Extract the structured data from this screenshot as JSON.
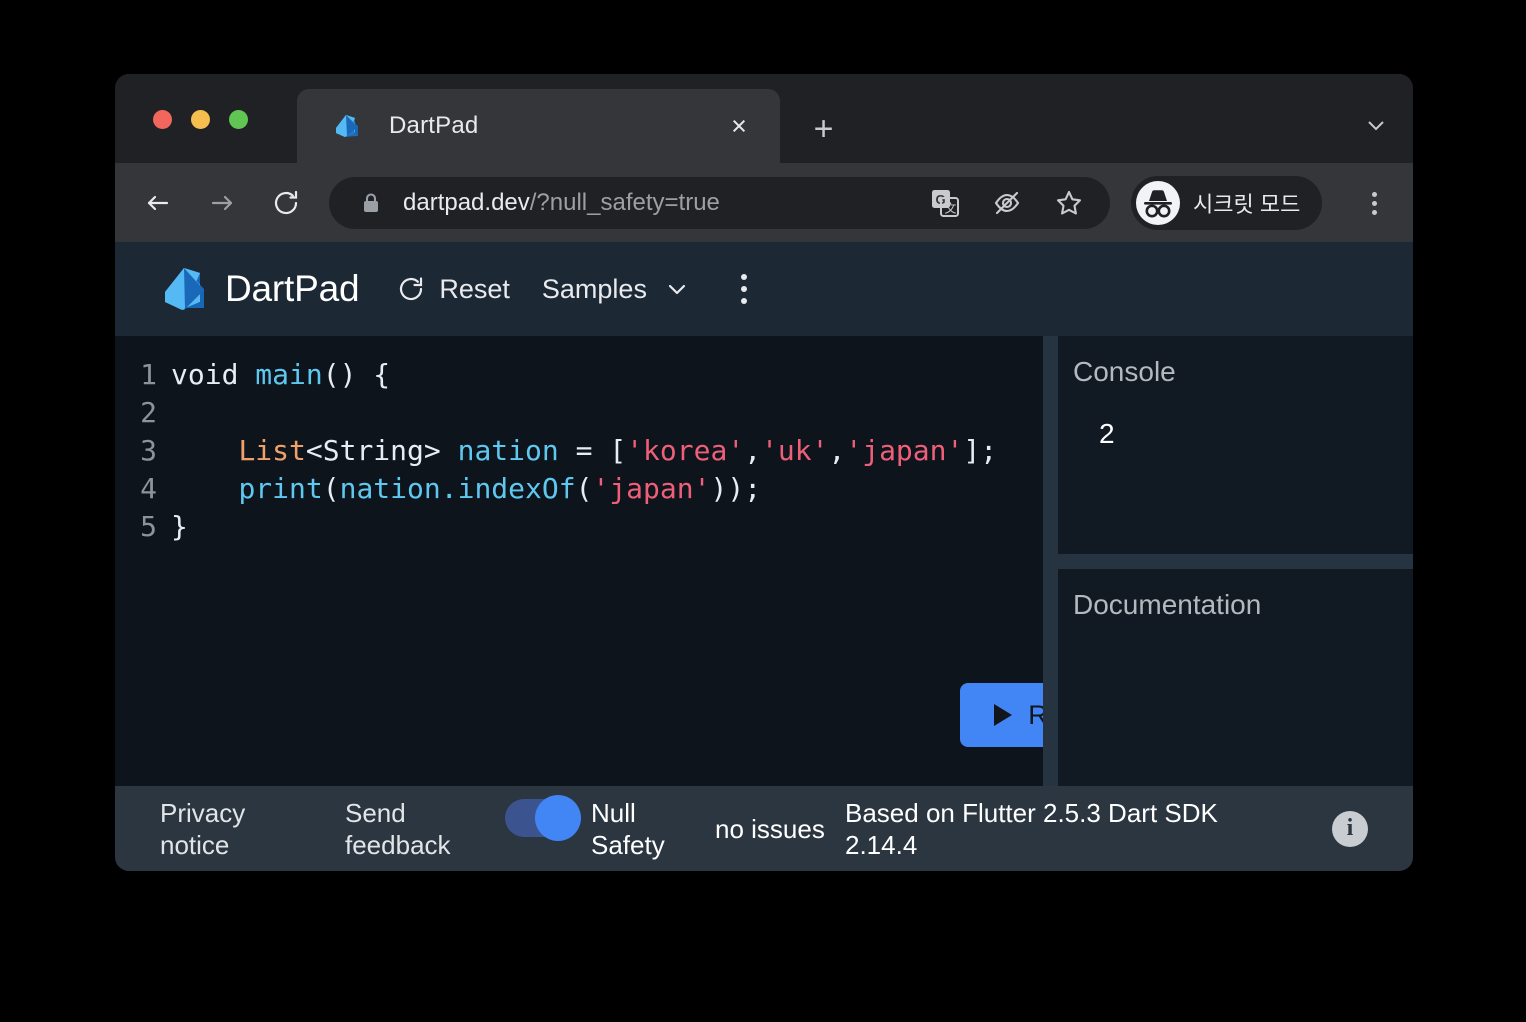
{
  "browser": {
    "tab": {
      "title": "DartPad",
      "favicon": "dart-logo-icon",
      "close": "×"
    },
    "new_tab": "+",
    "tabstrip_chevron": "chevron-down-icon",
    "omnibox": {
      "url_host": "dartpad.dev",
      "url_path": "/?null_safety=true",
      "lock": "lock-icon"
    },
    "omni_actions": [
      "translate-icon",
      "eye-off-icon",
      "star-icon"
    ],
    "profile": {
      "label": "시크릿 모드",
      "icon": "incognito-icon"
    },
    "menu": "chrome-menu-icon"
  },
  "dartpad": {
    "brand": "DartPad",
    "reset_label": "Reset",
    "samples_label": "Samples",
    "menu": "more-vert-icon",
    "run_label": "Run",
    "editor": {
      "lines": [
        {
          "n": "1",
          "tokens": [
            {
              "t": "void ",
              "c": "kw"
            },
            {
              "t": "main",
              "c": "fn"
            },
            {
              "t": "() {",
              "c": "pl"
            }
          ]
        },
        {
          "n": "2",
          "tokens": []
        },
        {
          "n": "3",
          "tokens": [
            {
              "t": "    ",
              "c": "pl"
            },
            {
              "t": "List",
              "c": "type"
            },
            {
              "t": "<String> ",
              "c": "pl"
            },
            {
              "t": "nation",
              "c": "fn"
            },
            {
              "t": " = [",
              "c": "pl"
            },
            {
              "t": "'korea'",
              "c": "str"
            },
            {
              "t": ",",
              "c": "pl"
            },
            {
              "t": "'uk'",
              "c": "str"
            },
            {
              "t": ",",
              "c": "pl"
            },
            {
              "t": "'japan'",
              "c": "str"
            },
            {
              "t": "];",
              "c": "pl"
            }
          ]
        },
        {
          "n": "4",
          "tokens": [
            {
              "t": "    ",
              "c": "pl"
            },
            {
              "t": "print",
              "c": "fn"
            },
            {
              "t": "(",
              "c": "pl"
            },
            {
              "t": "nation.indexOf",
              "c": "fn"
            },
            {
              "t": "(",
              "c": "pl"
            },
            {
              "t": "'japan'",
              "c": "str"
            },
            {
              "t": "));",
              "c": "pl"
            }
          ]
        },
        {
          "n": "5",
          "tokens": [
            {
              "t": "}",
              "c": "pl"
            }
          ]
        }
      ]
    },
    "console": {
      "title": "Console",
      "output": "2"
    },
    "documentation": {
      "title": "Documentation",
      "body": ""
    },
    "status": {
      "privacy": "Privacy notice",
      "send_feedback": "Send feedback",
      "null_safety_label": "Null Safety",
      "null_safety_on": true,
      "issues": "no issues",
      "sdk_info": "Based on Flutter 2.5.3 Dart SDK 2.14.4",
      "info_badge": "i"
    }
  },
  "colors": {
    "accent": "#4285f4",
    "app_bg": "#0e141b",
    "header_bg": "#1c2834",
    "panel_bg": "#111922",
    "status_bg": "#2b3640",
    "string": "#ef5f79",
    "type": "#f2a069",
    "ident": "#5ec8f0"
  }
}
